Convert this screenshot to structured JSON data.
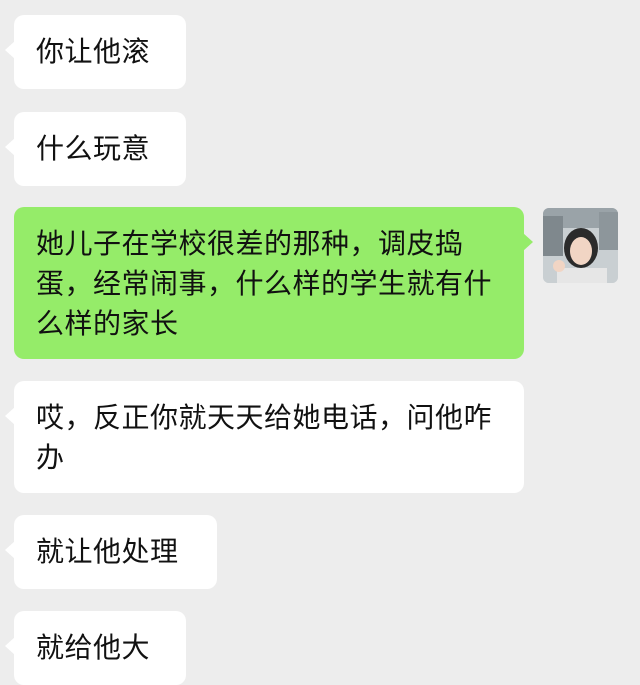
{
  "messages": [
    {
      "side": "incoming",
      "text": "你让他滚"
    },
    {
      "side": "incoming",
      "text": "什么玩意"
    },
    {
      "side": "outgoing",
      "text": "她儿子在学校很差的那种，调皮捣蛋，经常闹事，什么样的学生就有什么样的家长"
    },
    {
      "side": "incoming",
      "text": "哎，反正你就天天给她电话，问他咋办"
    },
    {
      "side": "incoming",
      "text": "就让他处理"
    },
    {
      "side": "incoming",
      "text": "就给他大"
    }
  ],
  "colors": {
    "background": "#ededed",
    "incoming_bubble": "#ffffff",
    "outgoing_bubble": "#95ec69",
    "text": "#111111"
  },
  "icons": {
    "avatar": "user-avatar-photo"
  }
}
